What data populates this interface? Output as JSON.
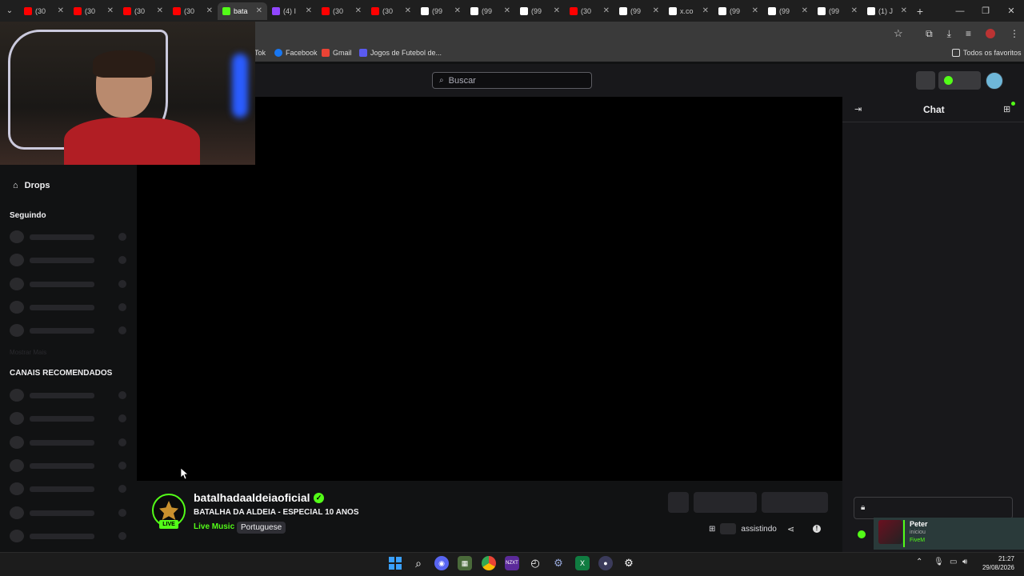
{
  "browser": {
    "tabs": [
      {
        "title": "(30",
        "icon": "youtube-icon",
        "color": "#ff0000"
      },
      {
        "title": "(30",
        "icon": "youtube-icon",
        "color": "#ff0000"
      },
      {
        "title": "(30",
        "icon": "youtube-icon",
        "color": "#ff0000"
      },
      {
        "title": "(30",
        "icon": "youtube-icon",
        "color": "#ff0000"
      },
      {
        "title": "bata",
        "icon": "kick-icon",
        "color": "#53fc18",
        "active": true
      },
      {
        "title": "(4) I",
        "icon": "twitch-icon",
        "color": "#9146ff"
      },
      {
        "title": "(30",
        "icon": "youtube-icon",
        "color": "#ff0000"
      },
      {
        "title": "(30",
        "icon": "youtube-icon",
        "color": "#ff0000"
      },
      {
        "title": "(99",
        "icon": "tiktok-icon",
        "color": "#ffffff"
      },
      {
        "title": "(99",
        "icon": "tiktok-icon",
        "color": "#ffffff"
      },
      {
        "title": "(99",
        "icon": "tiktok-icon",
        "color": "#ffffff"
      },
      {
        "title": "(30",
        "icon": "youtube-icon",
        "color": "#ff0000"
      },
      {
        "title": "(99",
        "icon": "tiktok-icon",
        "color": "#ffffff"
      },
      {
        "title": "x.co",
        "icon": "x-icon",
        "color": "#ffffff"
      },
      {
        "title": "(99",
        "icon": "tiktok-icon",
        "color": "#ffffff"
      },
      {
        "title": "(99",
        "icon": "tiktok-icon",
        "color": "#ffffff"
      },
      {
        "title": "(99",
        "icon": "tiktok-icon",
        "color": "#ffffff"
      },
      {
        "title": "(1) J",
        "icon": "x-icon",
        "color": "#ffffff"
      }
    ],
    "bookmarks": [
      {
        "label": "Tok",
        "color": "#ffffff"
      },
      {
        "label": "Facebook",
        "color": "#1877f2"
      },
      {
        "label": "Gmail",
        "color": "#ea4335"
      },
      {
        "label": "Jogos de Futebol de...",
        "color": "#5a5af0"
      }
    ],
    "all_bookmarks": "Todos os favoritos"
  },
  "header": {
    "search_placeholder": "Buscar"
  },
  "sidebar": {
    "drops_label": "Drops",
    "following_heading": "Seguindo",
    "following_placeholder_rows": 5,
    "show_more": "Mostrar Mais",
    "recommended_heading": "CANAIS RECOMENDADOS",
    "recommended_placeholder_rows": 7
  },
  "channel": {
    "name": "batalhadaaldeiaoficial",
    "live_badge": "LIVE",
    "title": "BATALHA DA ALDEIA - ESPECIAL 10 ANOS",
    "category": "Live Music",
    "language": "Portuguese",
    "viewers_label": "assistindo"
  },
  "chat": {
    "title": "Chat"
  },
  "toast": {
    "name": "Peter",
    "status": "iniciou",
    "game": "FiveM"
  },
  "taskbar": {
    "time": "21:27",
    "date": "29/08/2026"
  },
  "colors": {
    "accent": "#53fc18",
    "background": "#111213",
    "panel": "#18181b"
  }
}
